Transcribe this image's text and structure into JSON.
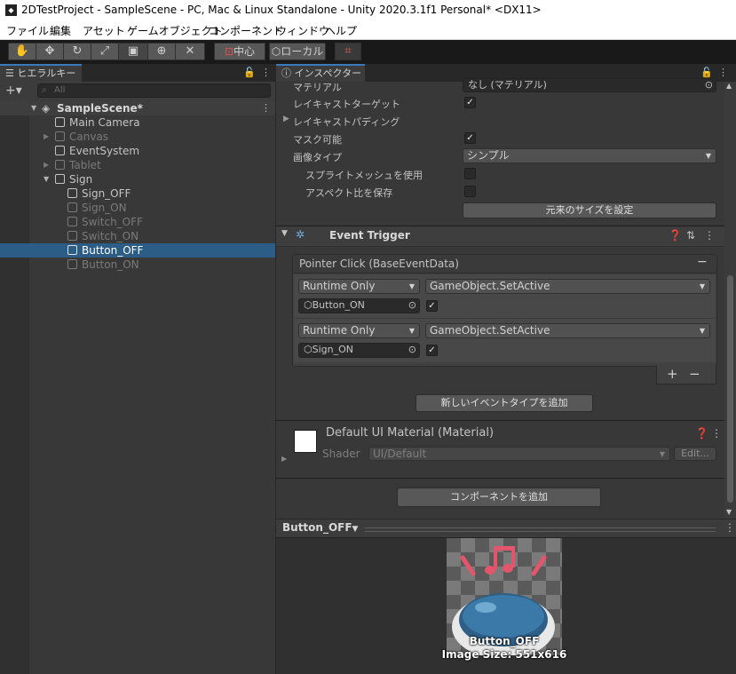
{
  "window": {
    "title": "2DTestProject - SampleScene - PC, Mac & Linux Standalone - Unity 2020.3.1f1 Personal* <DX11>"
  },
  "menu": [
    "ファイル",
    "編集",
    "アセット",
    "ゲームオブジェクト",
    "コンポーネント",
    "ウィンドウ",
    "ヘルプ"
  ],
  "toolbar": {
    "pivot_label": "中心",
    "space_label": "ローカル"
  },
  "hierarchy": {
    "tab_label": "ヒエラルキー",
    "search_placeholder": "All",
    "scene_name": "SampleScene*",
    "items": [
      {
        "label": "Main Camera",
        "active": true
      },
      {
        "label": "Canvas",
        "active": false
      },
      {
        "label": "EventSystem",
        "active": true
      },
      {
        "label": "Tablet",
        "active": false
      },
      {
        "label": "Sign",
        "active": true
      },
      {
        "label": "Sign_OFF",
        "active": true
      },
      {
        "label": "Sign_ON",
        "active": false
      },
      {
        "label": "Switch_OFF",
        "active": false
      },
      {
        "label": "Switch_ON",
        "active": false
      },
      {
        "label": "Button_OFF",
        "active": true,
        "selected": true
      },
      {
        "label": "Button_ON",
        "active": false
      }
    ]
  },
  "inspector": {
    "tab_label": "インスペクター",
    "material_label": "マテリアル",
    "material_value": "なし (マテリアル)",
    "raycast_target_label": "レイキャストターゲット",
    "raycast_padding_label": "レイキャストパディング",
    "maskable_label": "マスク可能",
    "image_type_label": "画像タイプ",
    "image_type_value": "シンプル",
    "sprite_mesh_label": "スプライトメッシュを使用",
    "preserve_aspect_label": "アスペクト比を保存",
    "set_native_size_button": "元来のサイズを設定",
    "event_trigger_title": "Event Trigger",
    "event_header": "Pointer Click (BaseEventData)",
    "events": [
      {
        "mode": "Runtime Only",
        "function": "GameObject.SetActive",
        "target": "Button_ON"
      },
      {
        "mode": "Runtime Only",
        "function": "GameObject.SetActive",
        "target": "Sign_ON"
      }
    ],
    "add_event_button": "新しいイベントタイプを追加",
    "material_title": "Default UI Material (Material)",
    "shader_label": "Shader",
    "shader_value": "UI/Default",
    "edit_button": "Edit...",
    "add_component_button": "コンポーネントを追加"
  },
  "preview": {
    "object_name": "Button_OFF",
    "caption_name": "Button_OFF",
    "caption_size": "Image Size: 551x616"
  }
}
